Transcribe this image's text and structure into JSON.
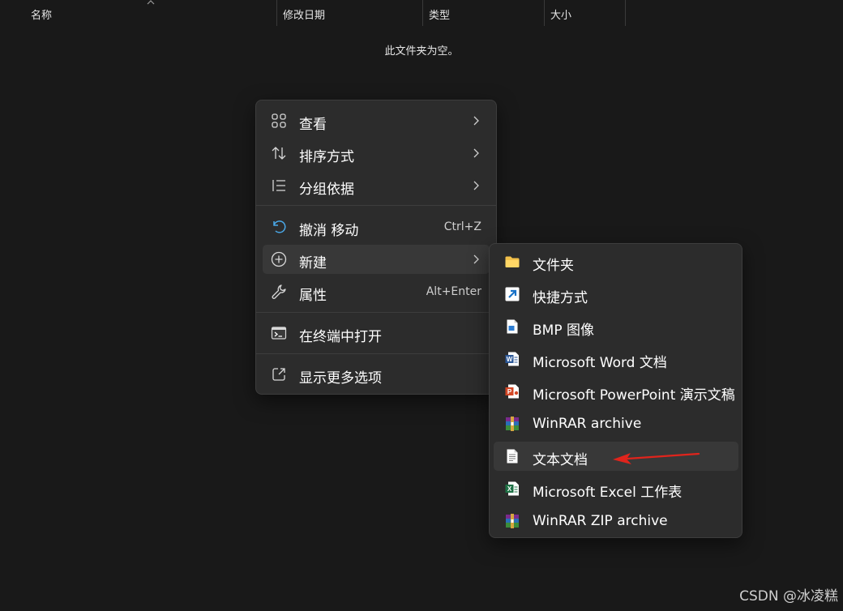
{
  "columns": {
    "name": "名称",
    "modified": "修改日期",
    "type": "类型",
    "size": "大小"
  },
  "empty_message": "此文件夹为空。",
  "context_menu": {
    "items": [
      {
        "label": "查看",
        "icon": "view-grid-icon",
        "submenu": true
      },
      {
        "label": "排序方式",
        "icon": "sort-icon",
        "submenu": true
      },
      {
        "label": "分组依据",
        "icon": "group-icon",
        "submenu": true
      },
      {
        "label": "撤消 移动",
        "icon": "undo-icon",
        "shortcut": "Ctrl+Z"
      },
      {
        "label": "新建",
        "icon": "new-plus-icon",
        "submenu": true,
        "highlighted": true
      },
      {
        "label": "属性",
        "icon": "wrench-icon",
        "shortcut": "Alt+Enter"
      },
      {
        "label": "在终端中打开",
        "icon": "terminal-icon"
      },
      {
        "label": "显示更多选项",
        "icon": "more-options-icon"
      }
    ]
  },
  "new_submenu": {
    "items": [
      {
        "label": "文件夹",
        "icon": "folder-icon"
      },
      {
        "label": "快捷方式",
        "icon": "shortcut-icon"
      },
      {
        "label": "BMP 图像",
        "icon": "bmp-icon"
      },
      {
        "label": "Microsoft Word 文档",
        "icon": "word-icon"
      },
      {
        "label": "Microsoft PowerPoint 演示文稿",
        "icon": "powerpoint-icon"
      },
      {
        "label": "WinRAR archive",
        "icon": "winrar-icon"
      },
      {
        "label": "文本文档",
        "icon": "text-document-icon",
        "highlighted": true
      },
      {
        "label": "Microsoft Excel 工作表",
        "icon": "excel-icon"
      },
      {
        "label": "WinRAR ZIP archive",
        "icon": "winrar-zip-icon"
      }
    ]
  },
  "colors": {
    "background": "#191919",
    "menu_background": "#2c2c2c",
    "highlight": "#383838",
    "accent_arrow": "#e0241c"
  },
  "watermark": "CSDN @冰凌糕"
}
